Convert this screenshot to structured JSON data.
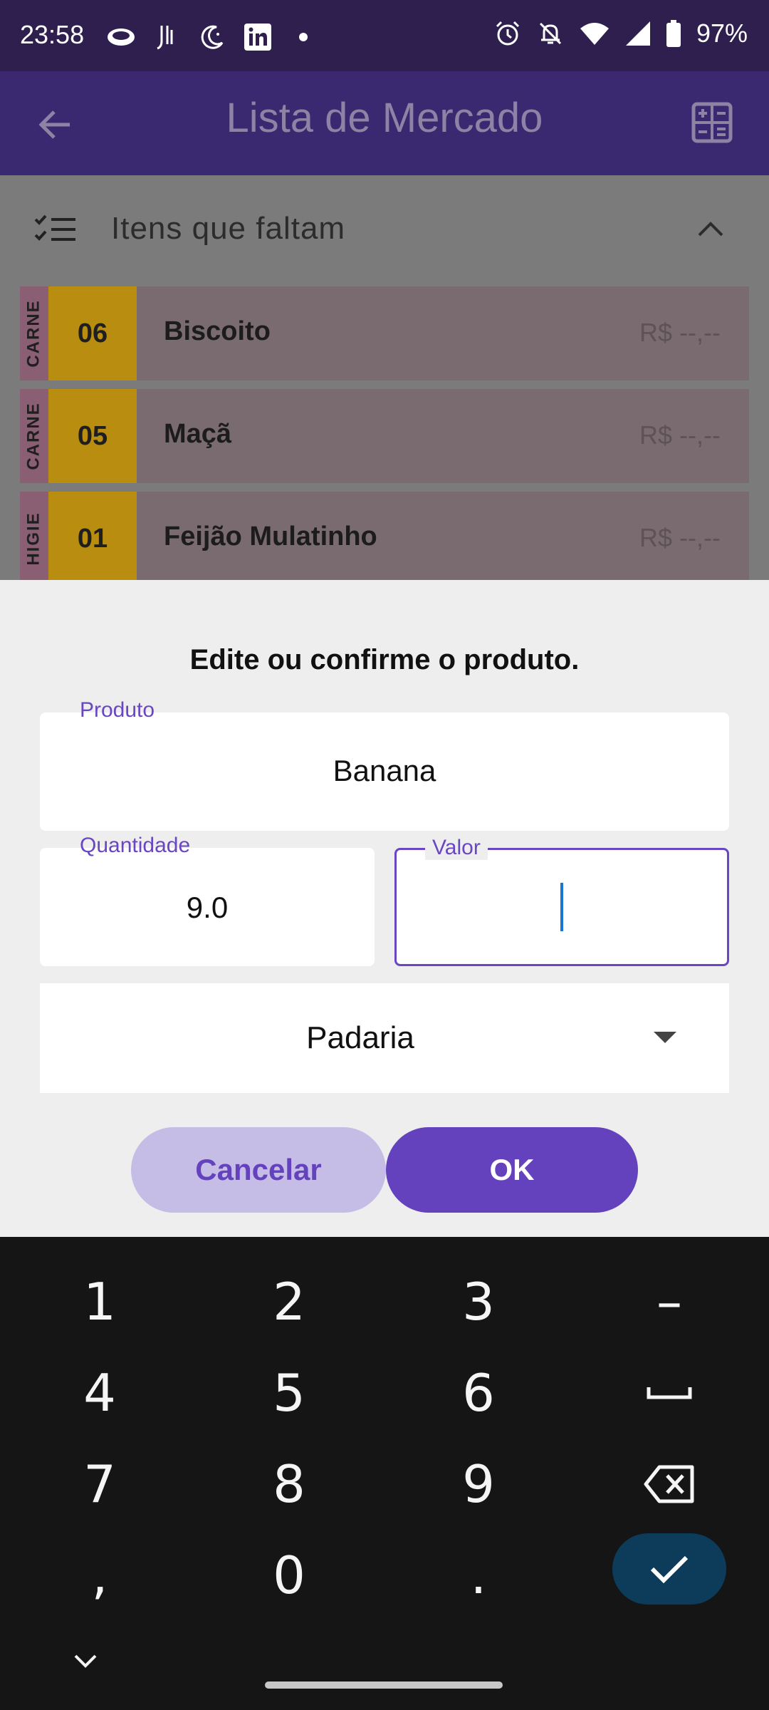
{
  "status_bar": {
    "time": "23:58",
    "battery": "97%",
    "left_icons": [
      "eye-icon",
      "app-icon",
      "moon-icon",
      "linkedin-icon",
      "dot-icon"
    ],
    "right_icons": [
      "alarm-icon",
      "mute-icon",
      "wifi-icon",
      "signal-icon",
      "battery-icon"
    ]
  },
  "appbar": {
    "title": "Lista de Mercado",
    "back_icon": "arrow-back-icon",
    "action_icon": "calculator-icon"
  },
  "section": {
    "label": "Itens que faltam",
    "icon": "checklist-icon",
    "toggle_icon": "chevron-up-icon"
  },
  "items": [
    {
      "category": "CARNE",
      "number": "06",
      "name": "Biscoito",
      "price": "R$ --,--"
    },
    {
      "category": "CARNE",
      "number": "05",
      "name": "Maçã",
      "price": "R$ --,--"
    },
    {
      "category": "HIGIE",
      "number": "01",
      "name": "Feijão Mulatinho",
      "price": "R$ --,--"
    }
  ],
  "dialog": {
    "title": "Edite ou confirme o produto.",
    "product_label": "Produto",
    "product_value": "Banana",
    "quantity_label": "Quantidade",
    "quantity_value": "9.0",
    "value_label": "Valor",
    "value_value": "",
    "category_value": "Padaria",
    "cancel_label": "Cancelar",
    "ok_label": "OK"
  },
  "keyboard": {
    "keys": [
      "1",
      "2",
      "3",
      "–",
      "4",
      "5",
      "6",
      "␣",
      "7",
      "8",
      "9",
      "⌫",
      ",",
      "0",
      "."
    ],
    "done_icon": "check-icon",
    "collapse_icon": "chevron-down-icon"
  },
  "colors": {
    "status_bar": "#2e1f4f",
    "app_bar": "#3a2870",
    "accent": "#6442be",
    "accent_light": "#c6bde7",
    "number_badge": "#b88d10",
    "keyboard_bg": "#151515",
    "done_key": "#0d3b5a"
  }
}
